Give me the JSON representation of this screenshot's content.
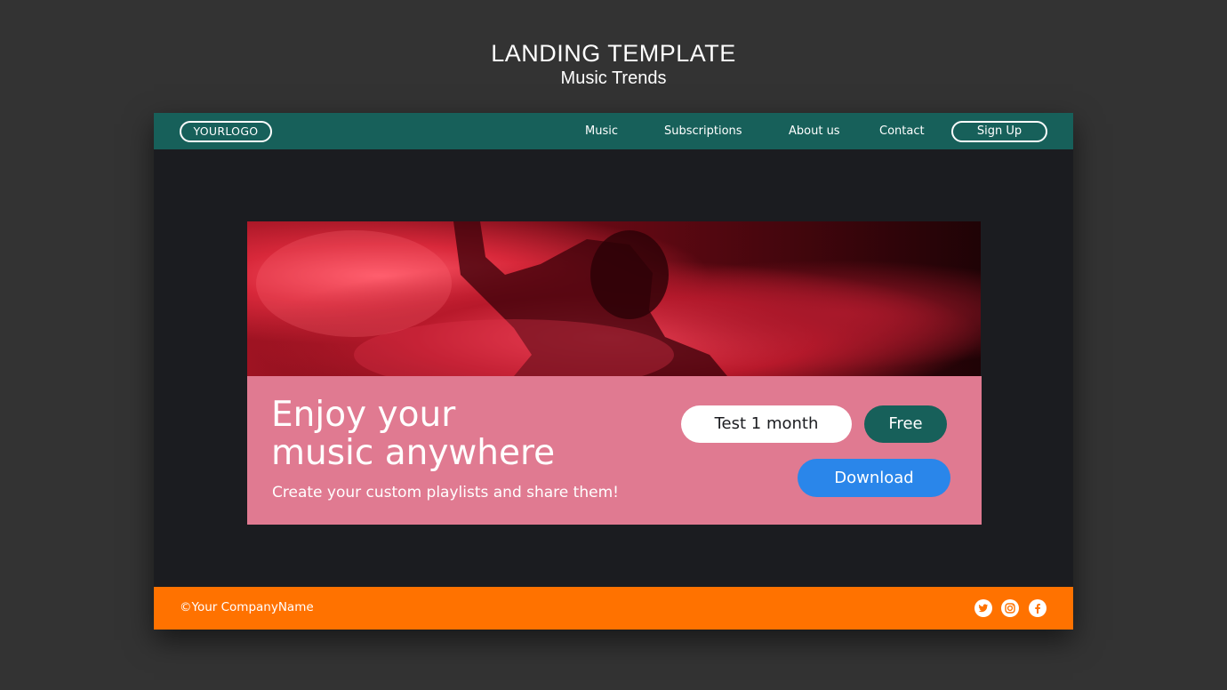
{
  "heading": {
    "title": "LANDING TEMPLATE",
    "subtitle": "Music Trends"
  },
  "navbar": {
    "logo": "YOURLOGO",
    "links": [
      "Music",
      "Subscriptions",
      "About us",
      "Contact"
    ],
    "signup_label": "Sign Up"
  },
  "hero": {
    "image_icon": "concert-crowd-red-smoke-photo"
  },
  "promo": {
    "headline_line1": "Enjoy your",
    "headline_line2": "music anywhere",
    "subtext": "Create your custom playlists and share them!",
    "test_label": "Test 1 month",
    "free_label": "Free",
    "download_label": "Download"
  },
  "footer": {
    "copyright": "©Your CompanyName",
    "social_icons": [
      "twitter-icon",
      "instagram-icon",
      "facebook-icon"
    ]
  },
  "colors": {
    "background": "#333333",
    "frame": "#1b1c20",
    "navbar": "#17605a",
    "promo_panel": "#e07a91",
    "free_button": "#17605a",
    "download_button": "#2a86ea",
    "footer": "#ff7200"
  }
}
